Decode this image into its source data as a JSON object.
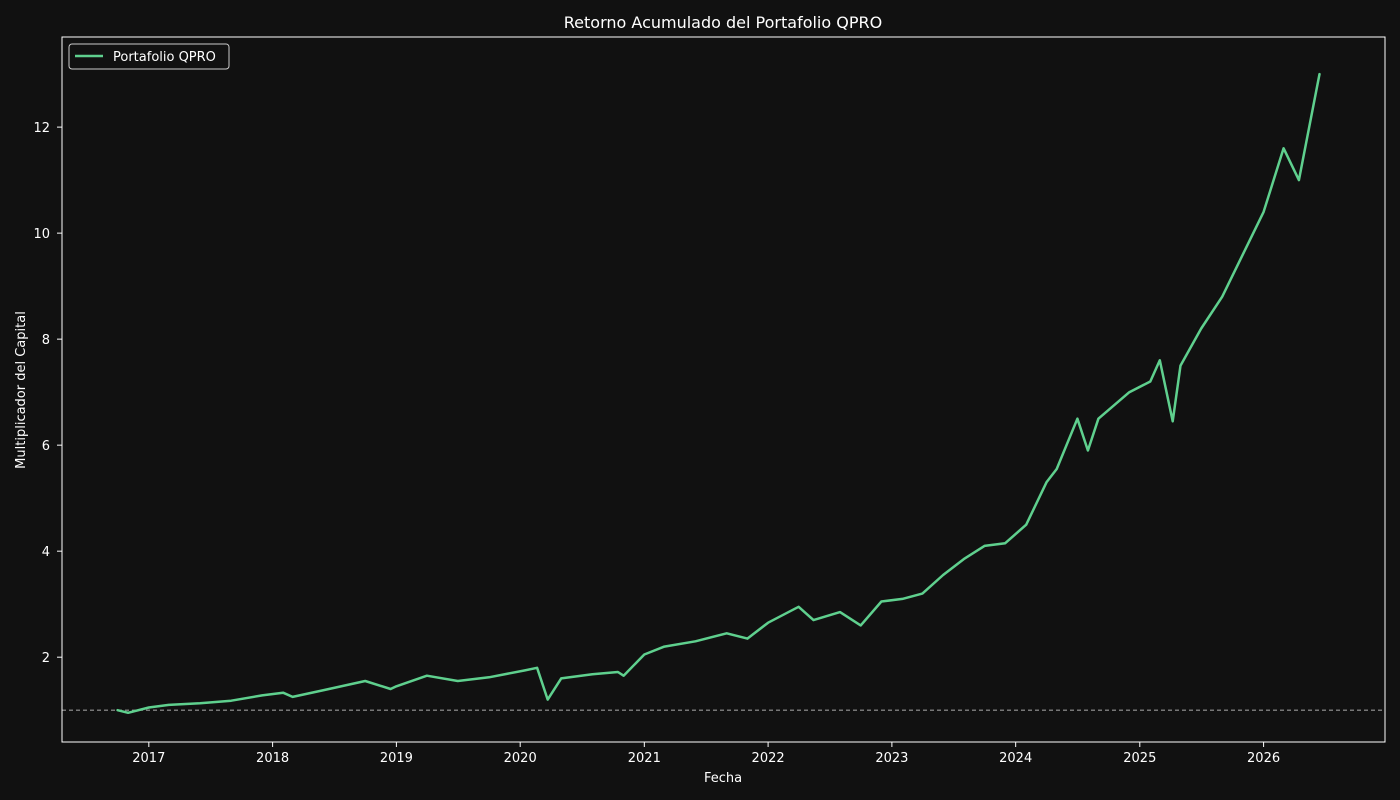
{
  "chart_data": {
    "type": "line",
    "title": "Retorno Acumulado del Portafolio QPRO",
    "xlabel": "Fecha",
    "ylabel": "Multiplicador del Capital",
    "x_ticks": [
      "2017",
      "2018",
      "2019",
      "2020",
      "2021",
      "2022",
      "2023",
      "2024",
      "2025",
      "2026"
    ],
    "y_ticks": [
      "2",
      "4",
      "6",
      "8",
      "10",
      "12"
    ],
    "x_range": [
      "2016-04-20",
      "2026-12-25"
    ],
    "ylim": [
      0.4,
      13.7
    ],
    "grid": false,
    "legend_position": "top-left",
    "reference_line": {
      "y": 1.0,
      "style": "dashed",
      "color": "#999999"
    },
    "series": [
      {
        "name": "Portafolio QPRO",
        "color": "#5fd08e",
        "x": [
          "2016-10-01",
          "2016-11-01",
          "2017-01-01",
          "2017-03-01",
          "2017-06-01",
          "2017-09-01",
          "2017-12-01",
          "2018-02-01",
          "2018-03-01",
          "2018-06-01",
          "2018-10-01",
          "2018-12-15",
          "2019-01-01",
          "2019-04-01",
          "2019-07-01",
          "2019-10-01",
          "2020-01-15",
          "2020-02-20",
          "2020-03-22",
          "2020-05-01",
          "2020-08-01",
          "2020-10-15",
          "2020-11-01",
          "2021-01-01",
          "2021-03-01",
          "2021-06-01",
          "2021-09-01",
          "2021-11-01",
          "2022-01-01",
          "2022-04-01",
          "2022-05-15",
          "2022-08-01",
          "2022-10-01",
          "2022-12-01",
          "2023-02-01",
          "2023-04-01",
          "2023-06-01",
          "2023-08-01",
          "2023-10-01",
          "2023-12-01",
          "2024-02-01",
          "2024-04-01",
          "2024-05-01",
          "2024-07-01",
          "2024-08-01",
          "2024-09-01",
          "2024-12-01",
          "2025-02-01",
          "2025-03-01",
          "2025-04-08",
          "2025-05-01",
          "2025-07-01",
          "2025-09-01",
          "2025-11-01",
          "2026-01-01",
          "2026-03-01",
          "2026-04-15",
          "2026-06-15"
        ],
        "y": [
          1.0,
          0.95,
          1.05,
          1.1,
          1.13,
          1.18,
          1.28,
          1.33,
          1.25,
          1.38,
          1.55,
          1.4,
          1.45,
          1.65,
          1.55,
          1.62,
          1.75,
          1.8,
          1.2,
          1.6,
          1.68,
          1.72,
          1.65,
          2.05,
          2.2,
          2.3,
          2.45,
          2.35,
          2.65,
          2.95,
          2.7,
          2.85,
          2.6,
          3.05,
          3.1,
          3.2,
          3.55,
          3.85,
          4.1,
          4.15,
          4.5,
          5.3,
          5.55,
          6.5,
          5.9,
          6.5,
          7.0,
          7.2,
          7.6,
          6.45,
          7.5,
          8.2,
          8.8,
          9.6,
          10.4,
          11.6,
          11.0,
          13.0
        ]
      }
    ]
  }
}
